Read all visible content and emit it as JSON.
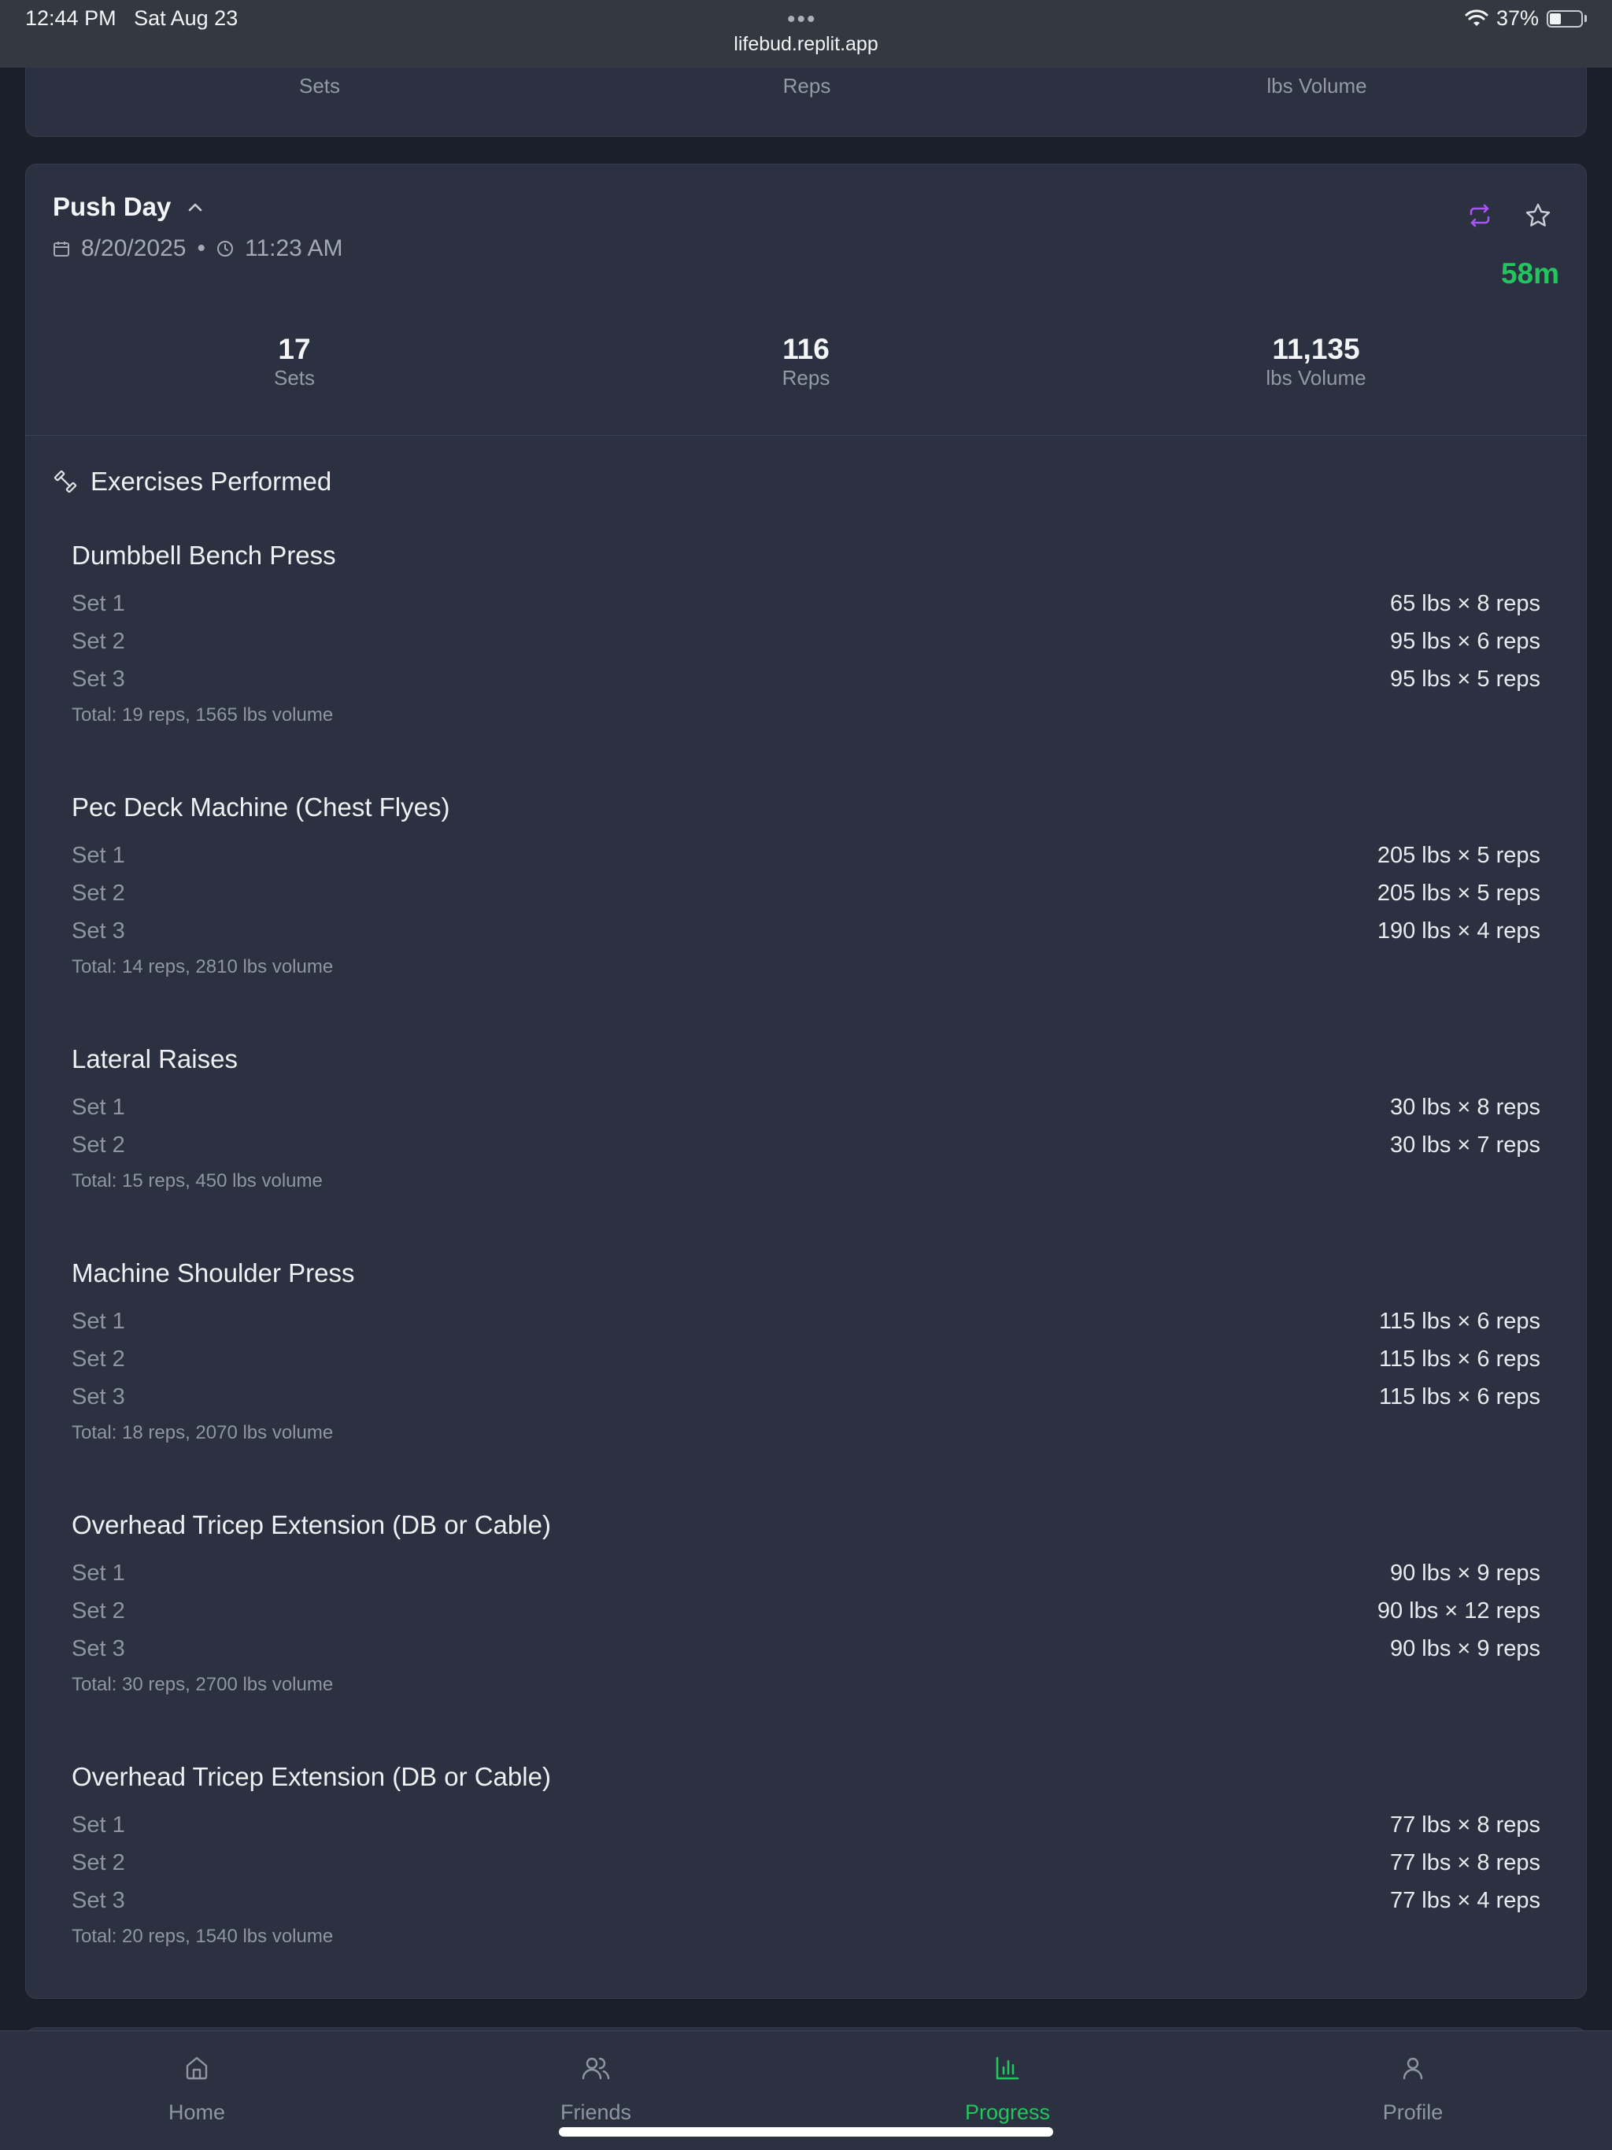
{
  "status_bar": {
    "time": "12:44 PM",
    "date": "Sat Aug 23",
    "url": "lifebud.replit.app",
    "battery": "37%",
    "battery_level": 0.37
  },
  "previous_card": {
    "stats": [
      {
        "label": "Sets"
      },
      {
        "label": "Reps"
      },
      {
        "label": "lbs Volume"
      }
    ]
  },
  "workout": {
    "title": "Push Day",
    "date": "8/20/2025",
    "separator": "•",
    "time": "11:23 AM",
    "duration": "58m",
    "stats": [
      {
        "value": "17",
        "label": "Sets"
      },
      {
        "value": "116",
        "label": "Reps"
      },
      {
        "value": "11,135",
        "label": "lbs Volume"
      }
    ],
    "exercises_heading": "Exercises Performed",
    "exercises": [
      {
        "name": "Dumbbell Bench Press",
        "sets": [
          {
            "label": "Set 1",
            "value": "65 lbs × 8 reps"
          },
          {
            "label": "Set 2",
            "value": "95 lbs × 6 reps"
          },
          {
            "label": "Set 3",
            "value": "95 lbs × 5 reps"
          }
        ],
        "total": "Total: 19 reps, 1565 lbs volume"
      },
      {
        "name": "Pec Deck Machine (Chest Flyes)",
        "sets": [
          {
            "label": "Set 1",
            "value": "205 lbs × 5 reps"
          },
          {
            "label": "Set 2",
            "value": "205 lbs × 5 reps"
          },
          {
            "label": "Set 3",
            "value": "190 lbs × 4 reps"
          }
        ],
        "total": "Total: 14 reps, 2810 lbs volume"
      },
      {
        "name": "Lateral Raises",
        "sets": [
          {
            "label": "Set 1",
            "value": "30 lbs × 8 reps"
          },
          {
            "label": "Set 2",
            "value": "30 lbs × 7 reps"
          }
        ],
        "total": "Total: 15 reps, 450 lbs volume"
      },
      {
        "name": "Machine Shoulder Press",
        "sets": [
          {
            "label": "Set 1",
            "value": "115 lbs × 6 reps"
          },
          {
            "label": "Set 2",
            "value": "115 lbs × 6 reps"
          },
          {
            "label": "Set 3",
            "value": "115 lbs × 6 reps"
          }
        ],
        "total": "Total: 18 reps, 2070 lbs volume"
      },
      {
        "name": "Overhead Tricep Extension (DB or Cable)",
        "sets": [
          {
            "label": "Set 1",
            "value": "90 lbs × 9 reps"
          },
          {
            "label": "Set 2",
            "value": "90 lbs × 12 reps"
          },
          {
            "label": "Set 3",
            "value": "90 lbs × 9 reps"
          }
        ],
        "total": "Total: 30 reps, 2700 lbs volume"
      },
      {
        "name": "Overhead Tricep Extension (DB or Cable)",
        "sets": [
          {
            "label": "Set 1",
            "value": "77 lbs × 8 reps"
          },
          {
            "label": "Set 2",
            "value": "77 lbs × 8 reps"
          },
          {
            "label": "Set 3",
            "value": "77 lbs × 4 reps"
          }
        ],
        "total": "Total: 20 reps, 1540 lbs volume"
      }
    ]
  },
  "nav": {
    "items": [
      {
        "label": "Home",
        "icon": "home-icon",
        "active": false
      },
      {
        "label": "Friends",
        "icon": "users-icon",
        "active": false
      },
      {
        "label": "Progress",
        "icon": "bar-chart-icon",
        "active": true
      },
      {
        "label": "Profile",
        "icon": "user-icon",
        "active": false
      }
    ]
  },
  "colors": {
    "accent_green": "#22c55e",
    "accent_purple": "#a855f7",
    "card_bg": "#2b3140",
    "page_bg": "#1a1f29"
  }
}
